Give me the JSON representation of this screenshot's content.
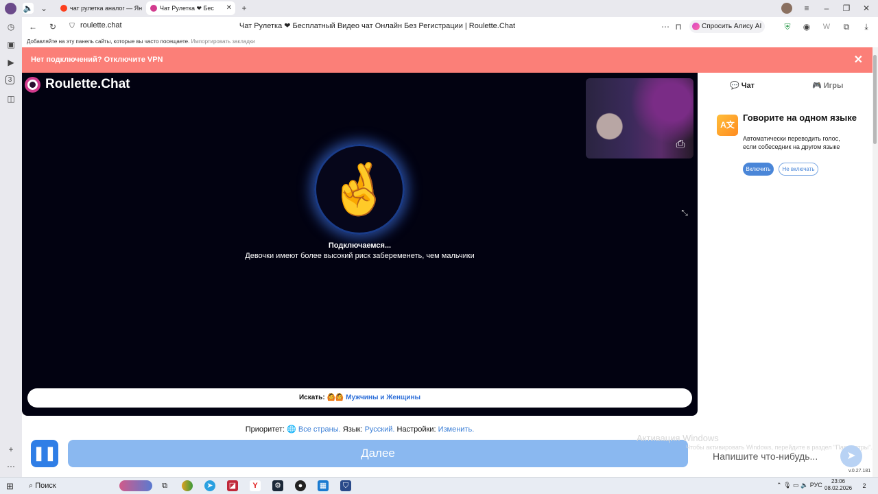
{
  "browser": {
    "tabs": [
      {
        "title": "чат рулетка аналог — Янде",
        "favicon_color": "#fc3f1d",
        "active": false
      },
      {
        "title": "Чат Рулетка ❤ Бес",
        "favicon_color": "#d23b8e",
        "active": true
      }
    ],
    "new_tab_symbol": "+",
    "url": "roulette.chat",
    "page_title": "Чат Рулетка ❤ Бесплатный Видео чат Онлайн Без Регистрации | Roulette.Chat",
    "alice_button": "Спросить Алису AI",
    "bookmarks_text": "Добавляйте на эту панель сайты, которые вы часто посещаете.",
    "bookmarks_import": "Импортировать закладки",
    "sidebar_badge": "3"
  },
  "banner": {
    "text": "Нет подключений? Отключите VPN",
    "close": "✕"
  },
  "video": {
    "logo": "Roulette.Chat",
    "status": "Подключаемся...",
    "fact": "Девочки имеют более высокий риск забеременеть, чем мальчики",
    "avatar_emoji": "🤞",
    "search_label": "Искать:",
    "search_emoji": "🙆🙆",
    "search_value": "Мужчины и Женщины"
  },
  "right_panel": {
    "tab_chat": "Чат",
    "tab_games": "Игры",
    "translate_icon": "A文",
    "translate_title": "Говорите на одном языке",
    "translate_text": "Автоматически переводить голос, если собеседник на другом языке",
    "enable_button": "Включить",
    "disable_button": "Не включать"
  },
  "settings_line": {
    "priority_label": "Приоритет:",
    "priority_value": "Все страны.",
    "language_label": "Язык:",
    "language_value": "Русский.",
    "settings_label": "Настройки:",
    "settings_value": "Изменить."
  },
  "controls": {
    "pause_symbol": "❚❚",
    "next_button": "Далее",
    "message_placeholder": "Напишите что-нибудь...",
    "version": "v.0.27.181"
  },
  "windows_watermark": {
    "title": "Активация Windows",
    "subtitle": "Чтобы активировать Windows, перейдите в раздел \"Параметры\"."
  },
  "taskbar": {
    "search": "Поиск",
    "language": "РУС",
    "time": "23:06",
    "date": "08.02.2026",
    "notifications": "2"
  }
}
